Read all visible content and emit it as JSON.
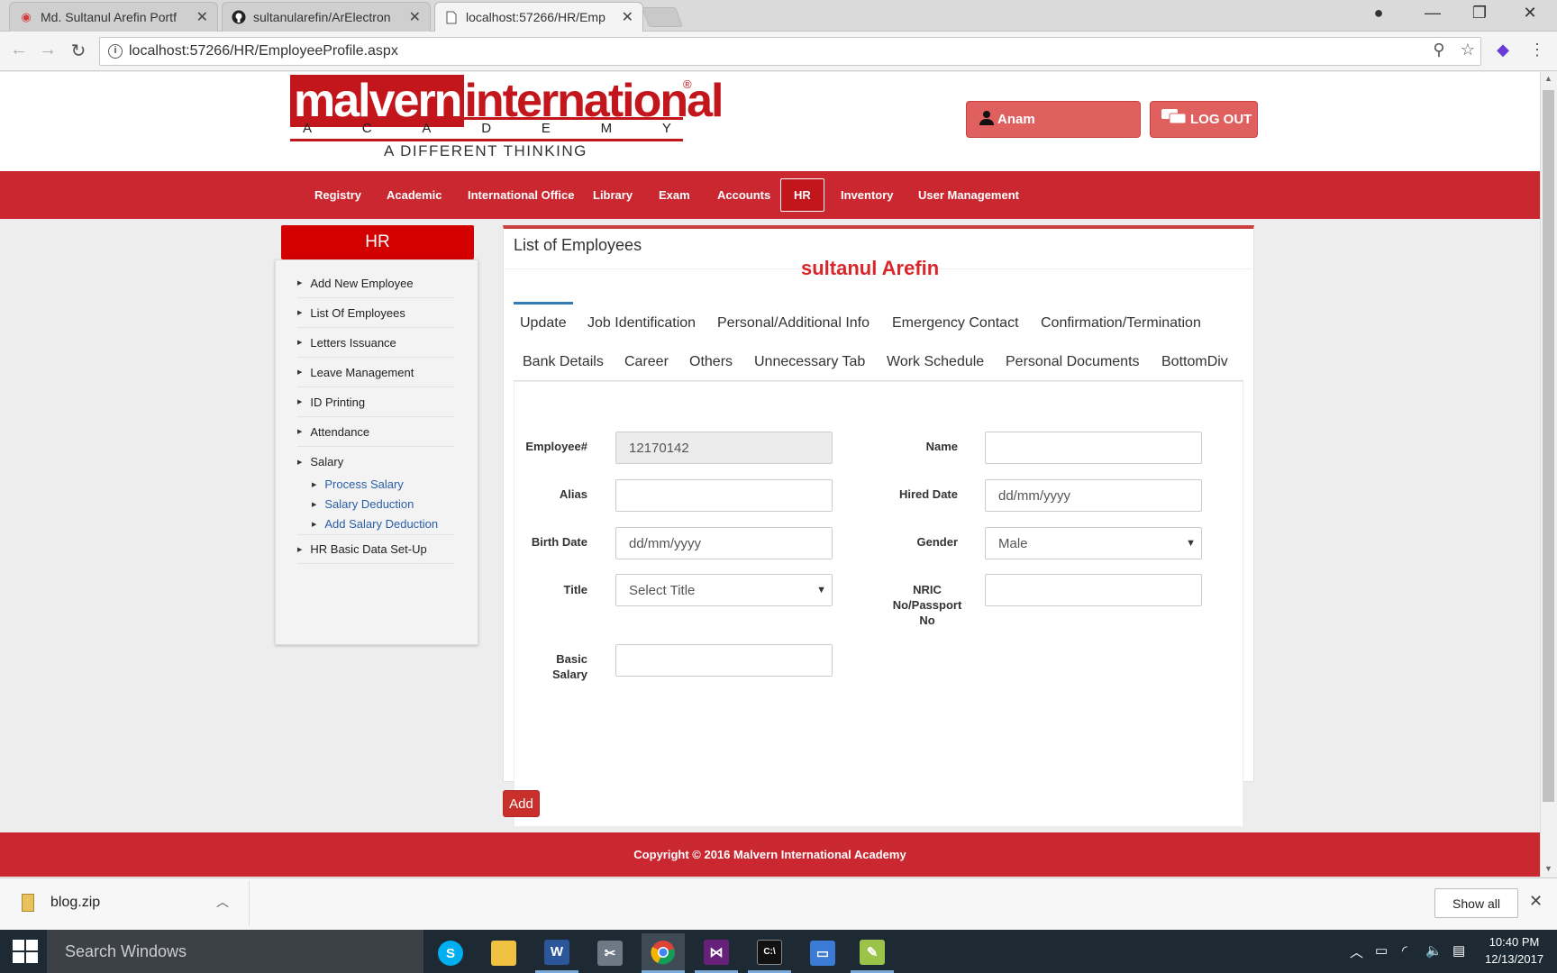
{
  "browser": {
    "tabs": [
      {
        "title": "Md. Sultanul Arefin Portf",
        "icon": "red-glasses-icon"
      },
      {
        "title": "sultanularefin/ArElectron",
        "icon": "github-icon"
      },
      {
        "title": "localhost:57266/HR/Emp",
        "icon": "page-icon",
        "active": true
      }
    ],
    "url": "localhost:57266/HR/EmployeeProfile.aspx"
  },
  "site": {
    "logo": {
      "part1": "malvern",
      "part2": "international",
      "registered": "®",
      "academy_letters": [
        "A",
        "C",
        "A",
        "D",
        "E",
        "M",
        "Y"
      ],
      "tagline": "A DIFFERENT THINKING"
    },
    "user_label": "Anam",
    "logout_label": "LOG OUT",
    "nav": [
      "Registry",
      "Academic",
      "International Office",
      "Library",
      "Exam",
      "Accounts",
      "HR",
      "Inventory",
      "User Management"
    ],
    "nav_active": "HR"
  },
  "sidebar": {
    "title": "HR",
    "items": [
      "Add New Employee",
      "List Of Employees",
      "Letters Issuance",
      "Leave Management",
      "ID Printing",
      "Attendance",
      "Salary"
    ],
    "sub_items": [
      "Process Salary",
      "Salary Deduction",
      "Add Salary Deduction"
    ],
    "last_item": "HR Basic Data Set-Up"
  },
  "panel": {
    "title": "List of Employees",
    "watermark": "sultanul Arefin",
    "tabs_row1": [
      "Update",
      "Job Identification",
      "Personal/Additional Info",
      "Emergency Contact",
      "Confirmation/Termination"
    ],
    "tabs_row2": [
      "Bank Details",
      "Career",
      "Others",
      "Unnecessary Tab",
      "Work Schedule",
      "Personal Documents",
      "BottomDiv"
    ],
    "active_tab": "Update"
  },
  "form": {
    "employee_label": "Employee#",
    "employee_value": "12170142",
    "name_label": "Name",
    "name_value": "",
    "alias_label": "Alias",
    "alias_value": "",
    "hired_label": "Hired Date",
    "hired_placeholder": "dd/mm/yyyy",
    "birth_label": "Birth Date",
    "birth_placeholder": "dd/mm/yyyy",
    "gender_label": "Gender",
    "gender_value": "Male",
    "title_label": "Title",
    "title_value": "Select Title",
    "nric_label_l1": "NRIC",
    "nric_label_l2": "No/Passport",
    "nric_label_l3": "No",
    "nric_value": "",
    "salary_label_l1": "Basic",
    "salary_label_l2": "Salary",
    "salary_value": ""
  },
  "add_button": "Add",
  "footer": "Copyright © 2016 Malvern International Academy",
  "download": {
    "file": "blog.zip",
    "show_all": "Show all"
  },
  "taskbar": {
    "search_placeholder": "Search Windows",
    "apps": [
      "skype-icon",
      "file-explorer-icon",
      "word-icon",
      "snipping-tool-icon",
      "chrome-icon",
      "visual-studio-icon",
      "cmd-icon",
      "remote-desktop-icon",
      "notepad-plus-icon"
    ],
    "time": "10:40 PM",
    "date": "12/13/2017"
  },
  "colors": {
    "brand_red": "#ca2730",
    "logo_red": "#c3161c",
    "user_button": "#e06060",
    "sidebar_head": "#d20000",
    "link_blue": "#2a5ea7"
  }
}
